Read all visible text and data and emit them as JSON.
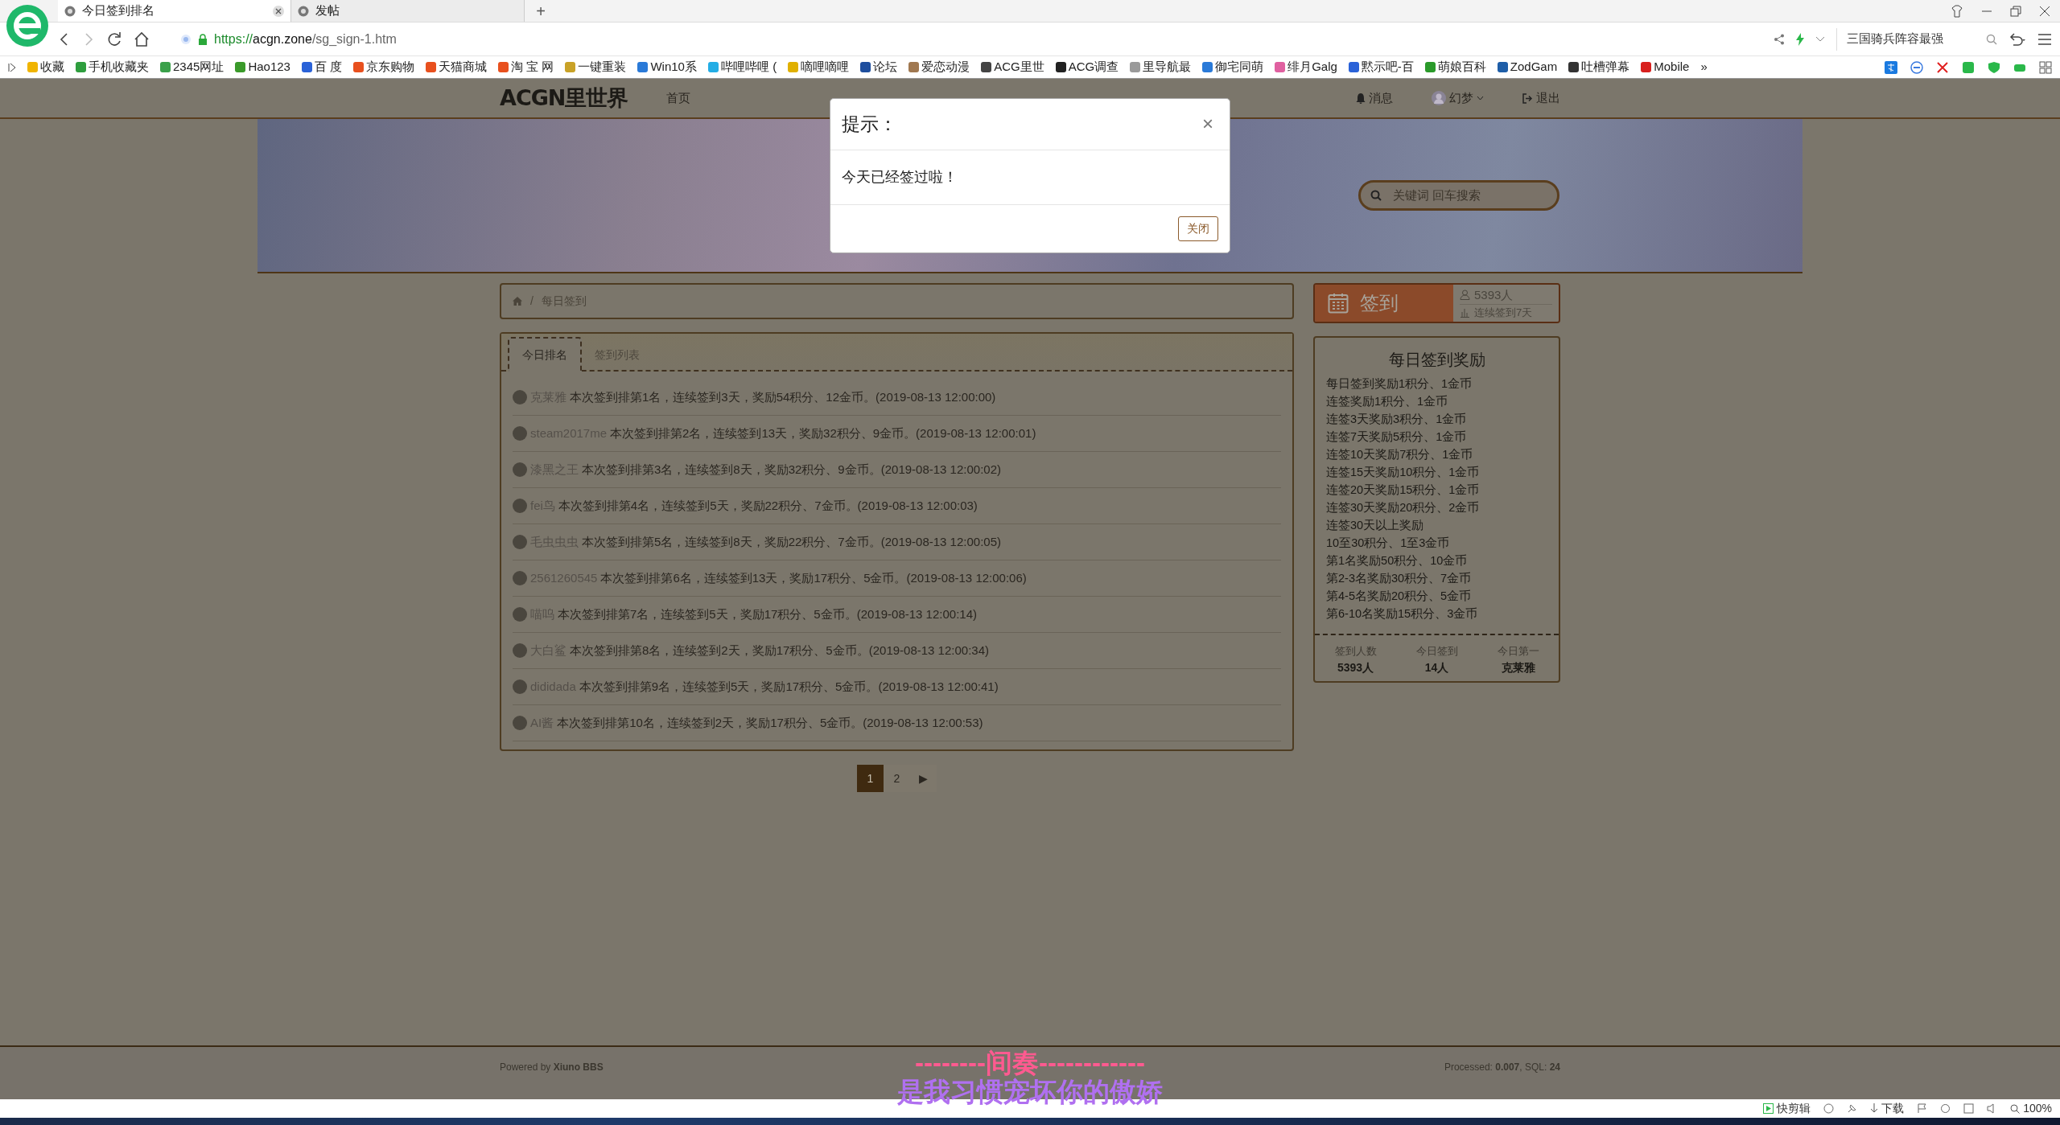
{
  "browser": {
    "tabs": [
      {
        "title": "今日签到排名",
        "selected": true
      },
      {
        "title": "发帖",
        "selected": false
      }
    ],
    "new_tab": "+",
    "url": {
      "scheme": "https://",
      "host": "acgn.zone",
      "path": "/sg_sign-1.htm"
    },
    "search": "三国骑兵阵容最强",
    "bookmarks": [
      {
        "label": "收藏",
        "color": "#f0b400"
      },
      {
        "label": "手机收藏夹",
        "color": "#2e9e3e"
      },
      {
        "label": "2345网址",
        "color": "#3aa04a"
      },
      {
        "label": "Hao123",
        "color": "#3a9a2a"
      },
      {
        "label": "百 度",
        "color": "#2a62d8"
      },
      {
        "label": "京东购物",
        "color": "#e8501e"
      },
      {
        "label": "天猫商城",
        "color": "#e8501e"
      },
      {
        "label": "淘 宝 网",
        "color": "#e8501e"
      },
      {
        "label": "一键重装",
        "color": "#c9a227"
      },
      {
        "label": "Win10系",
        "color": "#2a7ad8"
      },
      {
        "label": "哔哩哔哩 (",
        "color": "#23ade5"
      },
      {
        "label": "嘀哩嘀哩",
        "color": "#e0b000"
      },
      {
        "label": "论坛",
        "color": "#1e4e9e"
      },
      {
        "label": "爱恋动漫",
        "color": "#a07850"
      },
      {
        "label": "ACG里世",
        "color": "#444444"
      },
      {
        "label": "ACG调查",
        "color": "#222222"
      },
      {
        "label": "里导航最",
        "color": "#9a9a9a"
      },
      {
        "label": "御宅同萌",
        "color": "#2a7ad8"
      },
      {
        "label": "绯月Galg",
        "color": "#e060a0"
      },
      {
        "label": "黙示吧-百",
        "color": "#2a62d8"
      },
      {
        "label": "萌娘百科",
        "color": "#2a9a2a"
      },
      {
        "label": "ZodGam",
        "color": "#1e5ea8"
      },
      {
        "label": "吐槽弹幕",
        "color": "#333333"
      },
      {
        "label": "Mobile",
        "color": "#d8201e"
      }
    ],
    "bookmarks_more": "»"
  },
  "site": {
    "logo": "ACGN里世界",
    "nav": [
      {
        "label": "首页"
      }
    ],
    "messages": "消息",
    "user": "幻梦",
    "logout": "退出",
    "search_placeholder": "关键词 回车搜索"
  },
  "breadcrumb": {
    "separator": "/",
    "current": "每日签到"
  },
  "tabs": [
    {
      "label": "今日排名",
      "selected": true
    },
    {
      "label": "签到列表",
      "selected": false
    }
  ],
  "rows": [
    {
      "user": "克莱雅",
      "text": "本次签到排第1名，连续签到3天，奖励54积分、12金币。(2019-08-13 12:00:00)"
    },
    {
      "user": "steam2017me",
      "text": "本次签到排第2名，连续签到13天，奖励32积分、9金币。(2019-08-13 12:00:01)"
    },
    {
      "user": "漆黑之王",
      "text": "本次签到排第3名，连续签到8天，奖励32积分、9金币。(2019-08-13 12:00:02)"
    },
    {
      "user": "fei鸟",
      "text": "本次签到排第4名，连续签到5天，奖励22积分、7金币。(2019-08-13 12:00:03)"
    },
    {
      "user": "毛虫虫虫",
      "text": "本次签到排第5名，连续签到8天，奖励22积分、7金币。(2019-08-13 12:00:05)"
    },
    {
      "user": "2561260545",
      "text": "本次签到排第6名，连续签到13天，奖励17积分、5金币。(2019-08-13 12:00:06)"
    },
    {
      "user": "喵呜",
      "text": "本次签到排第7名，连续签到5天，奖励17积分、5金币。(2019-08-13 12:00:14)"
    },
    {
      "user": "大白鲨",
      "text": "本次签到排第8名，连续签到2天，奖励17积分、5金币。(2019-08-13 12:00:34)"
    },
    {
      "user": "dididada",
      "text": "本次签到排第9名，连续签到5天，奖励17积分、5金币。(2019-08-13 12:00:41)"
    },
    {
      "user": "AI酱",
      "text": "本次签到排第10名，连续签到2天，奖励17积分、5金币。(2019-08-13 12:00:53)"
    }
  ],
  "pagination": [
    {
      "label": "1",
      "selected": true
    },
    {
      "label": "2",
      "selected": false
    },
    {
      "label": "▶",
      "selected": false
    }
  ],
  "sign_card": {
    "label": "签到",
    "members": "5393人",
    "streak": "连续签到7天"
  },
  "rewards": {
    "title": "每日签到奖励",
    "lines": [
      "每日签到奖励1积分、1金币",
      "连签奖励1积分、1金币",
      "连签3天奖励3积分、1金币",
      "连签7天奖励5积分、1金币",
      "连签10天奖励7积分、1金币",
      "连签15天奖励10积分、1金币",
      "连签20天奖励15积分、1金币",
      "连签30天奖励20积分、2金币",
      "连签30天以上奖励",
      "10至30积分、1至3金币",
      "第1名奖励50积分、10金币",
      "第2-3名奖励30积分、7金币",
      "第4-5名奖励20积分、5金币",
      "第6-10名奖励15积分、3金币"
    ],
    "stats": [
      {
        "label": "签到人数",
        "value": "5393人"
      },
      {
        "label": "今日签到",
        "value": "14人"
      },
      {
        "label": "今日第一",
        "value": "克莱雅"
      }
    ]
  },
  "footer": {
    "powered": "Powered by **Xiuno BBS**",
    "processed": "Processed: **0.007**, SQL: **24**"
  },
  "modal": {
    "title": "提示：",
    "close": "×",
    "body": "今天已经签过啦！",
    "button": "关闭"
  },
  "lyrics": [
    "--------间奏------------",
    "是我习惯宠坏你的傲娇"
  ],
  "status_bar": {
    "clip": "快剪辑",
    "download": "下载",
    "zoom": "100%"
  }
}
